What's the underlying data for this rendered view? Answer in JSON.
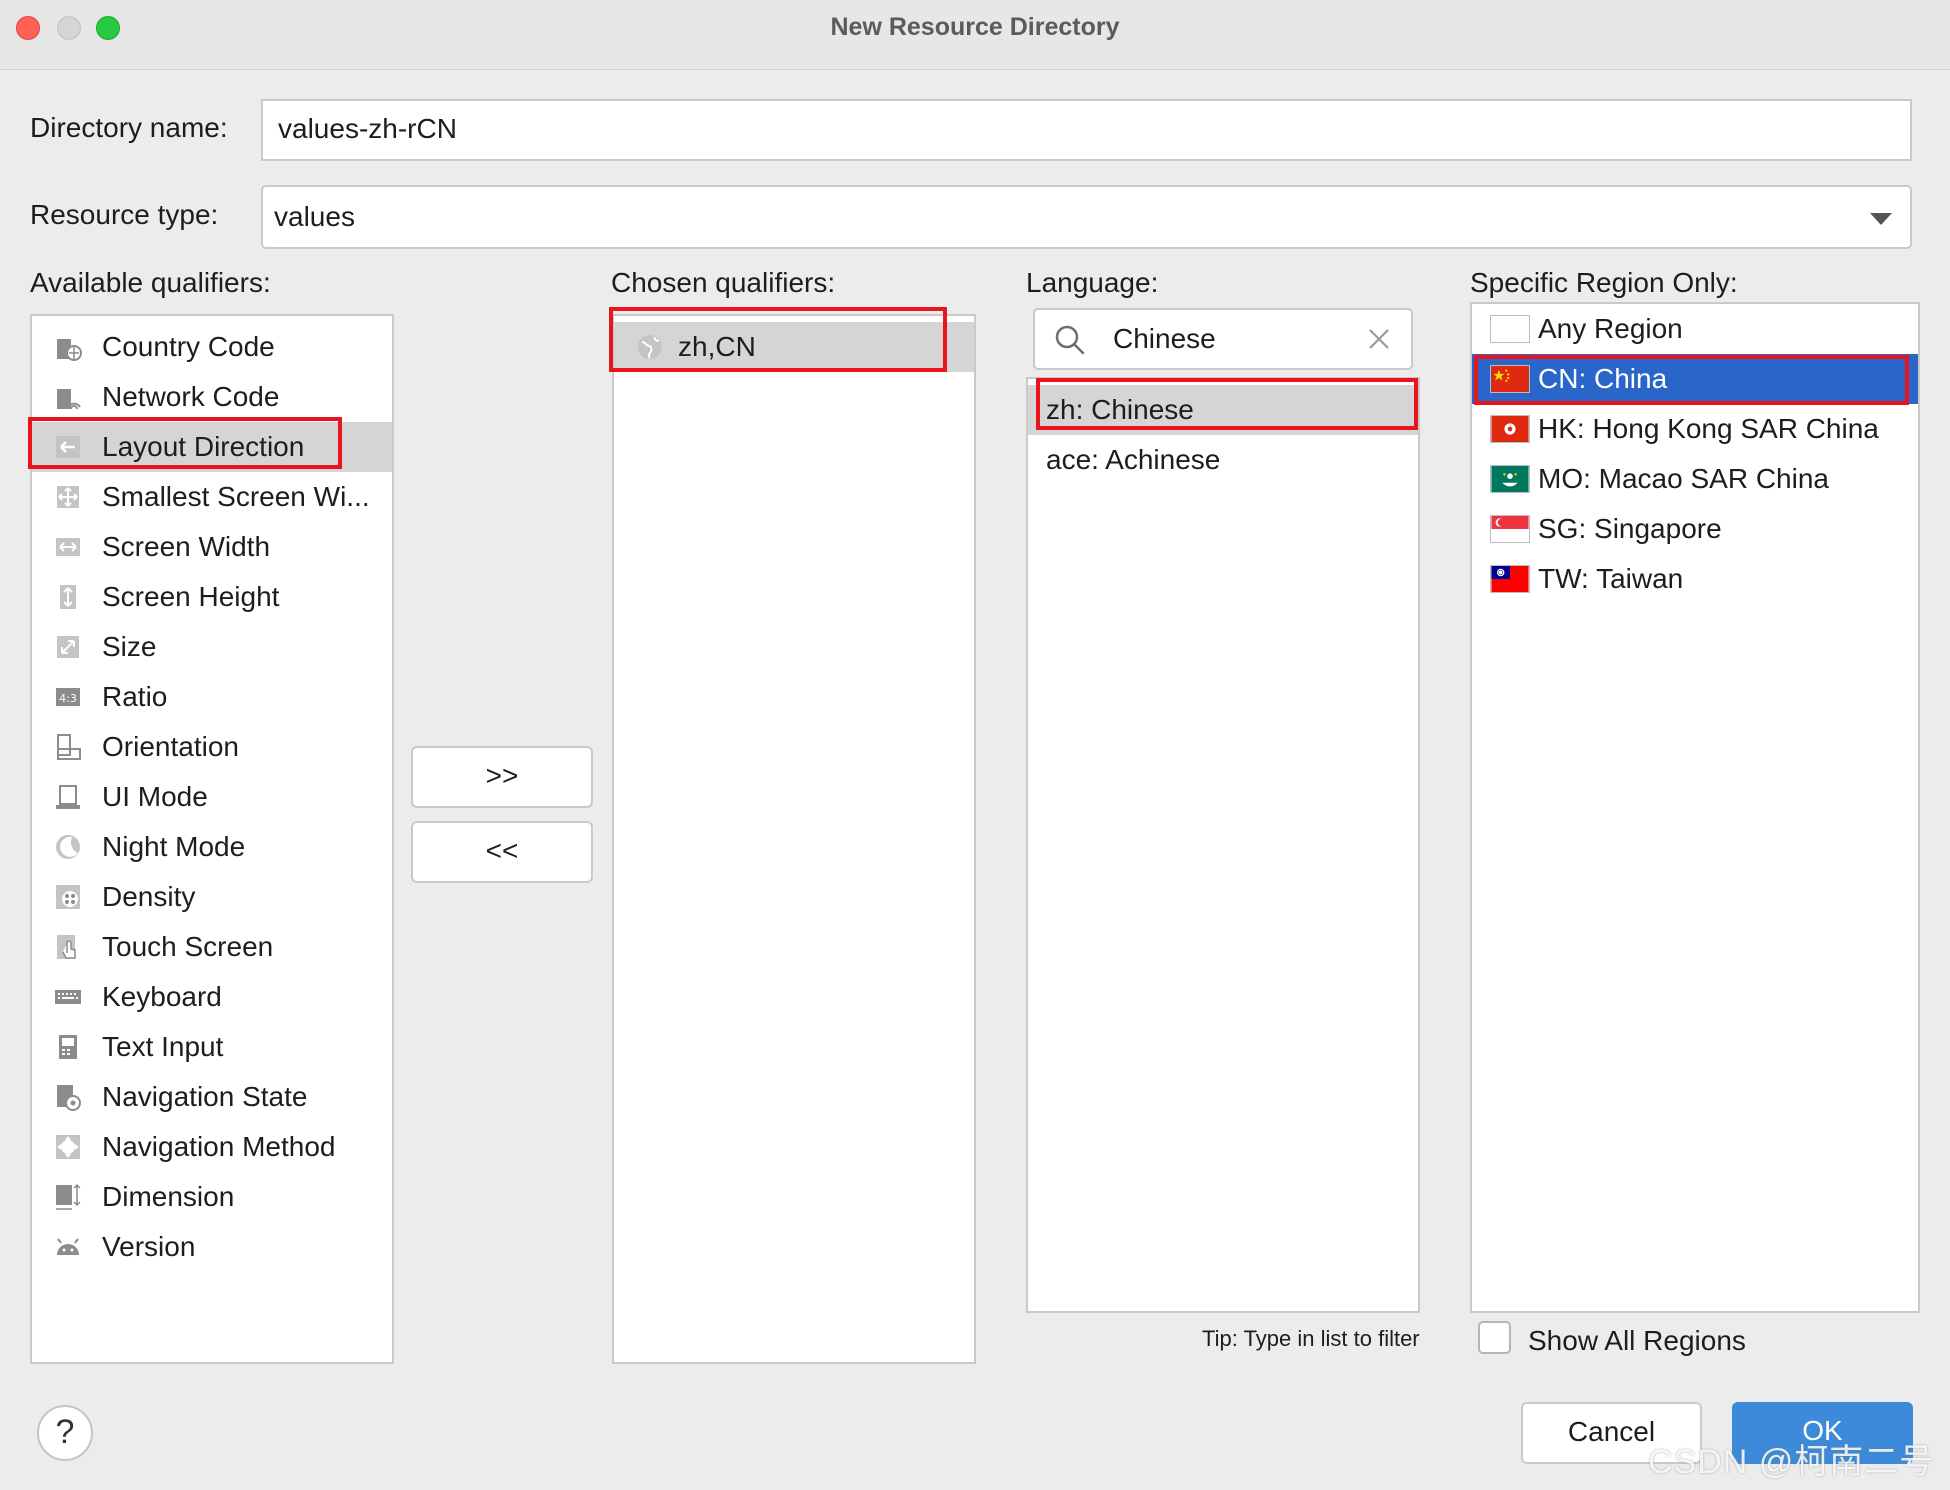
{
  "window": {
    "title": "New Resource Directory"
  },
  "form": {
    "directory_name_label": "Directory name:",
    "directory_name_value": "values-zh-rCN",
    "resource_type_label": "Resource type:",
    "resource_type_value": "values"
  },
  "available": {
    "label": "Available qualifiers:",
    "items": [
      {
        "label": "Country Code",
        "icon": "country-code-icon"
      },
      {
        "label": "Network Code",
        "icon": "network-code-icon"
      },
      {
        "label": "Layout Direction",
        "icon": "layout-direction-icon"
      },
      {
        "label": "Smallest Screen Wi...",
        "icon": "smallest-screen-width-icon"
      },
      {
        "label": "Screen Width",
        "icon": "screen-width-icon"
      },
      {
        "label": "Screen Height",
        "icon": "screen-height-icon"
      },
      {
        "label": "Size",
        "icon": "size-icon"
      },
      {
        "label": "Ratio",
        "icon": "ratio-icon"
      },
      {
        "label": "Orientation",
        "icon": "orientation-icon"
      },
      {
        "label": "UI Mode",
        "icon": "ui-mode-icon"
      },
      {
        "label": "Night Mode",
        "icon": "night-mode-icon"
      },
      {
        "label": "Density",
        "icon": "density-icon"
      },
      {
        "label": "Touch Screen",
        "icon": "touch-screen-icon"
      },
      {
        "label": "Keyboard",
        "icon": "keyboard-icon"
      },
      {
        "label": "Text Input",
        "icon": "text-input-icon"
      },
      {
        "label": "Navigation State",
        "icon": "navigation-state-icon"
      },
      {
        "label": "Navigation Method",
        "icon": "navigation-method-icon"
      },
      {
        "label": "Dimension",
        "icon": "dimension-icon"
      },
      {
        "label": "Version",
        "icon": "android-icon"
      }
    ],
    "selected": "Layout Direction"
  },
  "transfer": {
    "add_label": ">>",
    "remove_label": "<<"
  },
  "chosen": {
    "label": "Chosen qualifiers:",
    "items": [
      {
        "label": "zh,CN",
        "icon": "globe-icon"
      }
    ]
  },
  "language": {
    "label": "Language:",
    "search_value": "Chinese",
    "items": [
      {
        "label": "zh: Chinese"
      },
      {
        "label": "ace: Achinese"
      }
    ],
    "selected": "zh: Chinese",
    "tip": "Tip: Type in list to filter"
  },
  "region": {
    "label": "Specific Region Only:",
    "items": [
      {
        "label": "Any Region",
        "flag": "blank"
      },
      {
        "label": "CN: China",
        "flag": "cn-flag"
      },
      {
        "label": "HK: Hong Kong SAR China",
        "flag": "hk-flag"
      },
      {
        "label": "MO: Macao SAR China",
        "flag": "mo-flag"
      },
      {
        "label": "SG: Singapore",
        "flag": "sg-flag"
      },
      {
        "label": "TW: Taiwan",
        "flag": "tw-flag"
      }
    ],
    "selected": "CN: China",
    "show_all_label": "Show All Regions"
  },
  "footer": {
    "help_label": "?",
    "cancel_label": "Cancel",
    "ok_label": "OK",
    "watermark": "CSDN @柯南二号"
  },
  "colors": {
    "selection_blue": "#2a66c9",
    "highlight_red": "#e8141e",
    "ok_blue": "#3c8ad9"
  }
}
